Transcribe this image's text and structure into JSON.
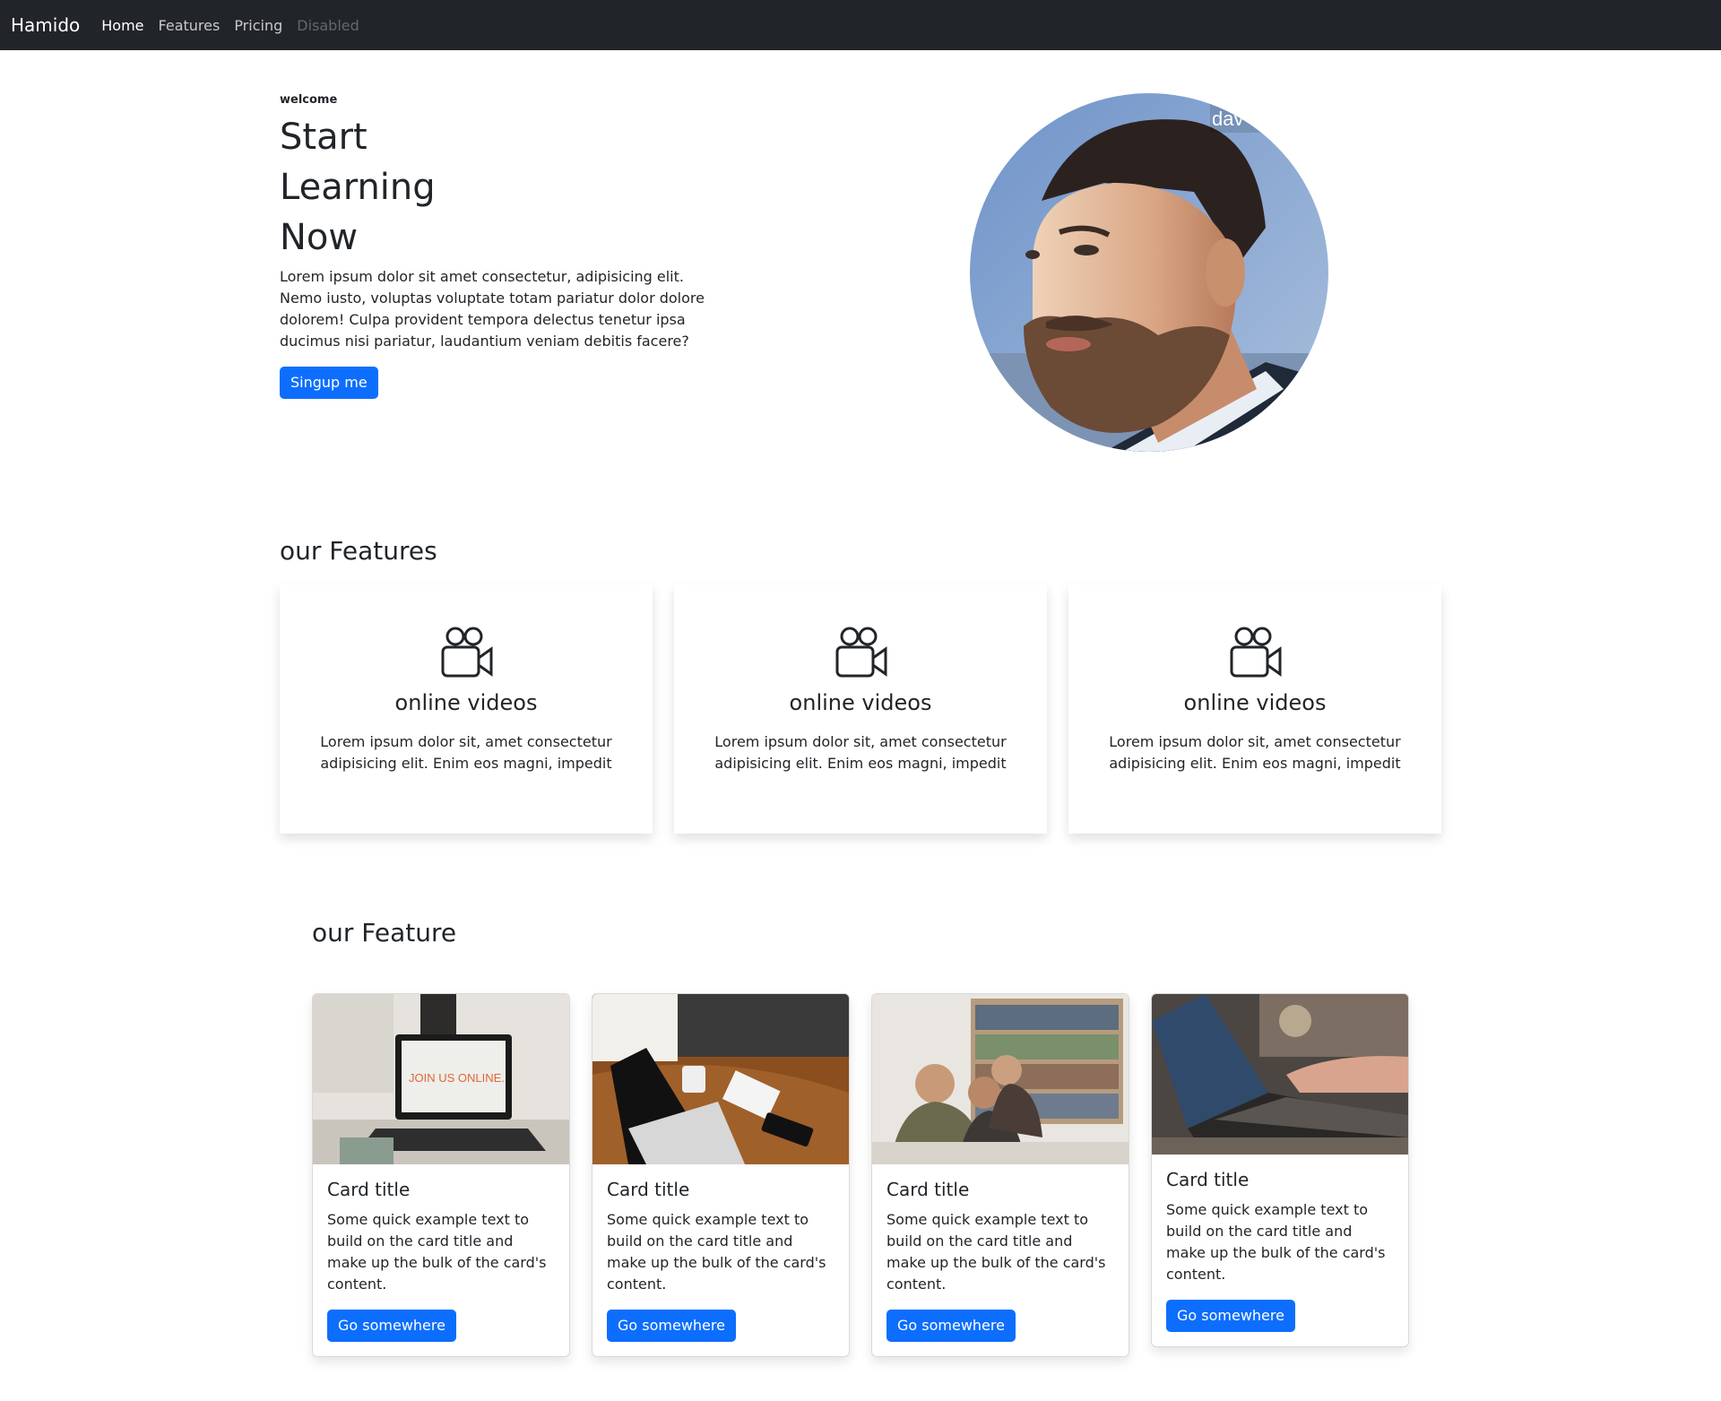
{
  "navbar": {
    "brand": "Hamido",
    "links": [
      {
        "label": "Home",
        "state": "active"
      },
      {
        "label": "Features",
        "state": "normal"
      },
      {
        "label": "Pricing",
        "state": "normal"
      },
      {
        "label": "Disabled",
        "state": "disabled"
      }
    ]
  },
  "hero": {
    "eyebrow": "welcome",
    "title_lines": [
      "Start",
      "Learning",
      "Now"
    ],
    "text": "Lorem ipsum dolor sit amet consectetur, adipisicing elit. Nemo iusto, voluptas voluptate totam pariatur dolor dolore dolorem! Culpa provident tempora delectus tenetur ipsa ducimus nisi pariatur, laudantium veniam debitis facere?",
    "button": "Singup me",
    "portrait_watermark": "dav"
  },
  "features": {
    "title": "our Features",
    "items": [
      {
        "icon": "video-camera-icon",
        "title": "online videos",
        "text": "Lorem ipsum dolor sit, amet consectetur adipisicing elit. Enim eos magni, impedit"
      },
      {
        "icon": "video-camera-icon",
        "title": "online videos",
        "text": "Lorem ipsum dolor sit, amet consectetur adipisicing elit. Enim eos magni, impedit"
      },
      {
        "icon": "video-camera-icon",
        "title": "online videos",
        "text": "Lorem ipsum dolor sit, amet consectetur adipisicing elit. Enim eos magni, impedit"
      }
    ]
  },
  "feature2": {
    "title": "our Feature",
    "cards": [
      {
        "image": "laptop-join-us-online-photo",
        "image_text": "JOIN US ONLINE.",
        "title": "Card title",
        "text": "Some quick example text to build on the card title and make up the bulk of the card's content.",
        "button": "Go somewhere"
      },
      {
        "image": "laptop-desk-coffee-photo",
        "title": "Card title",
        "text": "Some quick example text to build on the card title and make up the bulk of the card's content.",
        "button": "Go somewhere"
      },
      {
        "image": "people-library-photo",
        "title": "Card title",
        "text": "Some quick example text to build on the card title and make up the bulk of the card's content.",
        "button": "Go somewhere"
      },
      {
        "image": "hands-typing-laptop-photo",
        "title": "Card title",
        "text": "Some quick example text to build on the card title and make up the bulk of the card's content.",
        "button": "Go somewhere"
      }
    ]
  },
  "colors": {
    "navbar_bg": "#212529",
    "primary": "#0d6efd",
    "text": "#212529"
  }
}
